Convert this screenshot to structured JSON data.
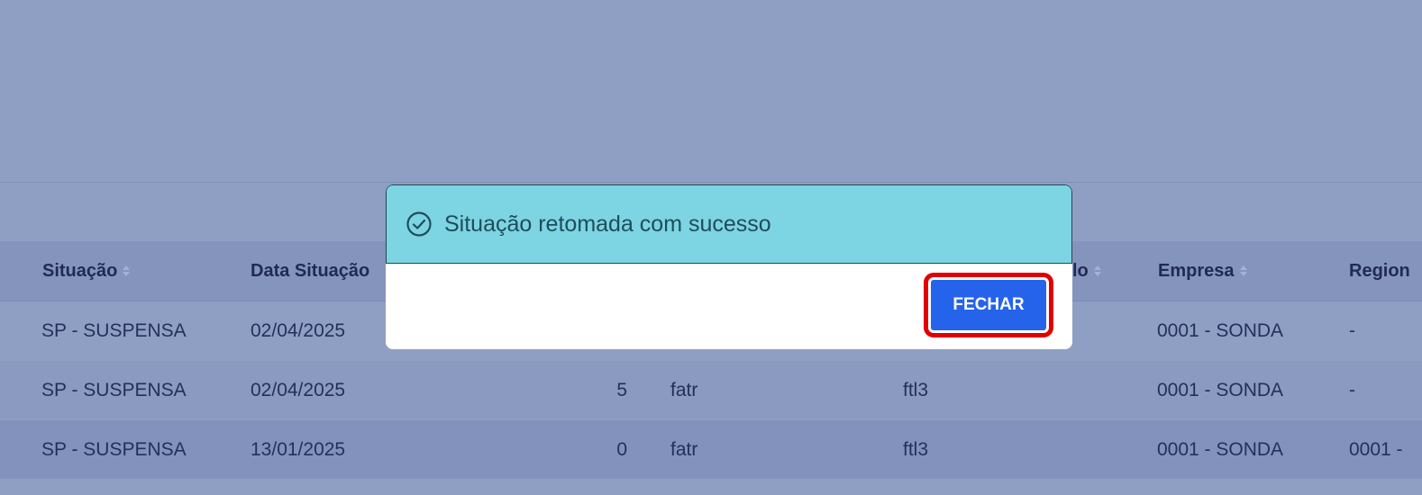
{
  "table": {
    "columns": [
      {
        "label": "Situação",
        "sortable": true
      },
      {
        "label": "Data Situação",
        "sortable": true
      },
      {
        "label": "lo",
        "sortable": true
      },
      {
        "label": "Empresa",
        "sortable": true
      },
      {
        "label": "Region",
        "sortable": false
      }
    ],
    "rows": [
      {
        "situacao": "SP - SUSPENSA",
        "data": "02/04/2025",
        "qtd": "",
        "usuario": "",
        "modulo": "",
        "empresa": "0001 - SONDA",
        "regional": "-"
      },
      {
        "situacao": "SP - SUSPENSA",
        "data": "02/04/2025",
        "qtd": "5",
        "usuario": "fatr",
        "modulo": "ftl3",
        "empresa": "0001 - SONDA",
        "regional": "-"
      },
      {
        "situacao": "SP - SUSPENSA",
        "data": "13/01/2025",
        "qtd": "0",
        "usuario": "fatr",
        "modulo": "ftl3",
        "empresa": "0001 - SONDA",
        "regional": "0001 -"
      }
    ]
  },
  "modal": {
    "icon": "check-circle-icon",
    "message": "Situação retomada com sucesso",
    "close_label": "FECHAR",
    "header_color": "#7dd4e3",
    "button_color": "#2563eb",
    "highlight_color": "#e00000"
  }
}
